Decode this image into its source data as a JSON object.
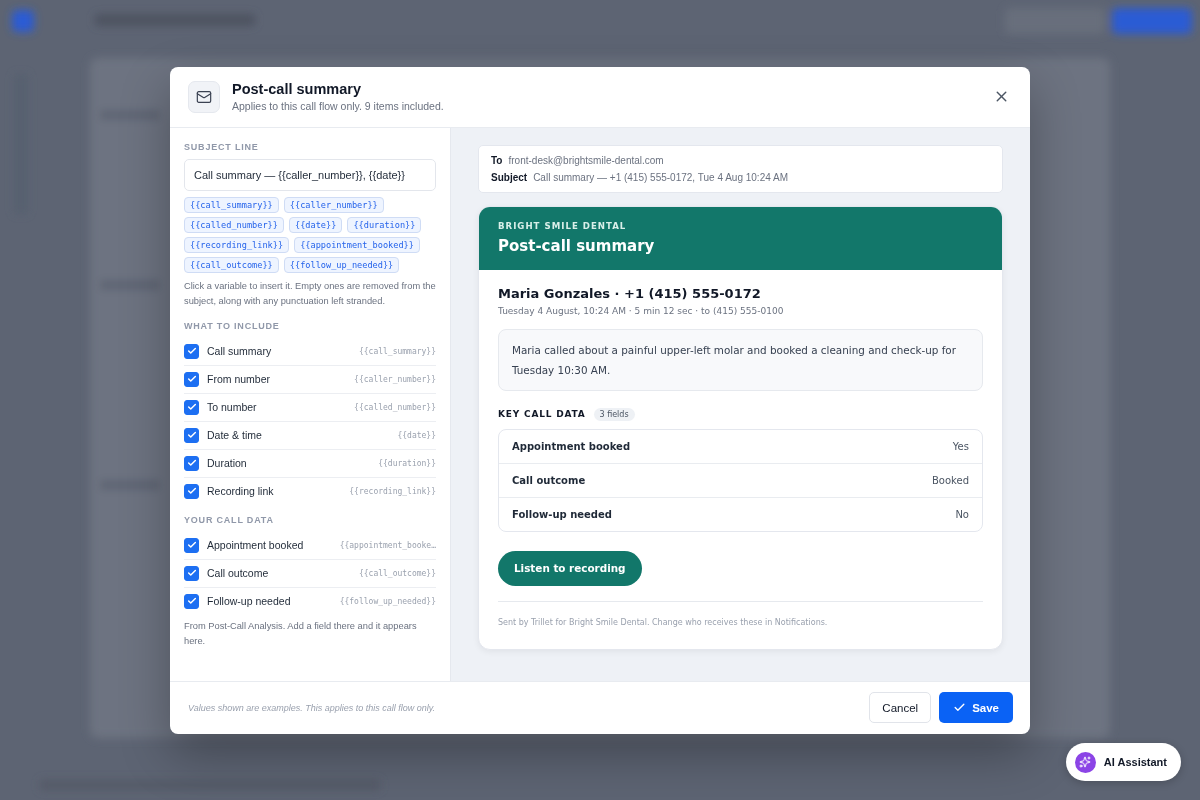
{
  "dialog": {
    "title": "Post-call summary",
    "subtitle": "Applies to this call flow only. 9 items included."
  },
  "subject_line": {
    "label": "SUBJECT LINE",
    "value": "Call summary — {{caller_number}}, {{date}}",
    "variables": [
      "{{call_summary}}",
      "{{caller_number}}",
      "{{called_number}}",
      "{{date}}",
      "{{duration}}",
      "{{recording_link}}",
      "{{appointment_booked}}",
      "{{call_outcome}}",
      "{{follow_up_needed}}"
    ],
    "hint": "Click a variable to insert it. Empty ones are removed from the subject, along with any punctuation left stranded."
  },
  "include": {
    "label": "WHAT TO INCLUDE",
    "items": [
      {
        "label": "Call summary",
        "variable": "{{call_summary}}",
        "checked": true
      },
      {
        "label": "From number",
        "variable": "{{caller_number}}",
        "checked": true
      },
      {
        "label": "To number",
        "variable": "{{called_number}}",
        "checked": true
      },
      {
        "label": "Date & time",
        "variable": "{{date}}",
        "checked": true
      },
      {
        "label": "Duration",
        "variable": "{{duration}}",
        "checked": true
      },
      {
        "label": "Recording link",
        "variable": "{{recording_link}}",
        "checked": true
      }
    ]
  },
  "call_data": {
    "label": "YOUR CALL DATA",
    "items": [
      {
        "label": "Appointment booked",
        "variable": "{{appointment_booke…",
        "checked": true
      },
      {
        "label": "Call outcome",
        "variable": "{{call_outcome}}",
        "checked": true
      },
      {
        "label": "Follow-up needed",
        "variable": "{{follow_up_needed}}",
        "checked": true
      }
    ],
    "note": "From Post-Call Analysis. Add a field there and it appears here."
  },
  "preview": {
    "to_label": "To",
    "to": "front-desk@brightsmile-dental.com",
    "subject_label": "Subject",
    "subject": "Call summary — +1 (415) 555-0172, Tue 4 Aug 10:24 AM",
    "brand": "BRIGHT SMILE DENTAL",
    "heading": "Post-call summary",
    "caller": "Maria Gonzales · +1 (415) 555-0172",
    "meta": "Tuesday 4 August, 10:24 AM · 5 min 12 sec · to (415) 555-0100",
    "summary": "Maria called about a painful upper-left molar and booked a cleaning and check-up for Tuesday 10:30 AM.",
    "key_data_label": "KEY CALL DATA",
    "key_data_count": "3 fields",
    "key_data": [
      {
        "label": "Appointment booked",
        "value": "Yes"
      },
      {
        "label": "Call outcome",
        "value": "Booked"
      },
      {
        "label": "Follow-up needed",
        "value": "No"
      }
    ],
    "button": "Listen to recording",
    "footer": "Sent by Trillet for Bright Smile Dental. Change who receives these in Notifications."
  },
  "footer": {
    "note": "Values shown are examples. This applies to this call flow only.",
    "cancel": "Cancel",
    "save": "Save"
  },
  "assistant": {
    "label": "AI Assistant"
  }
}
